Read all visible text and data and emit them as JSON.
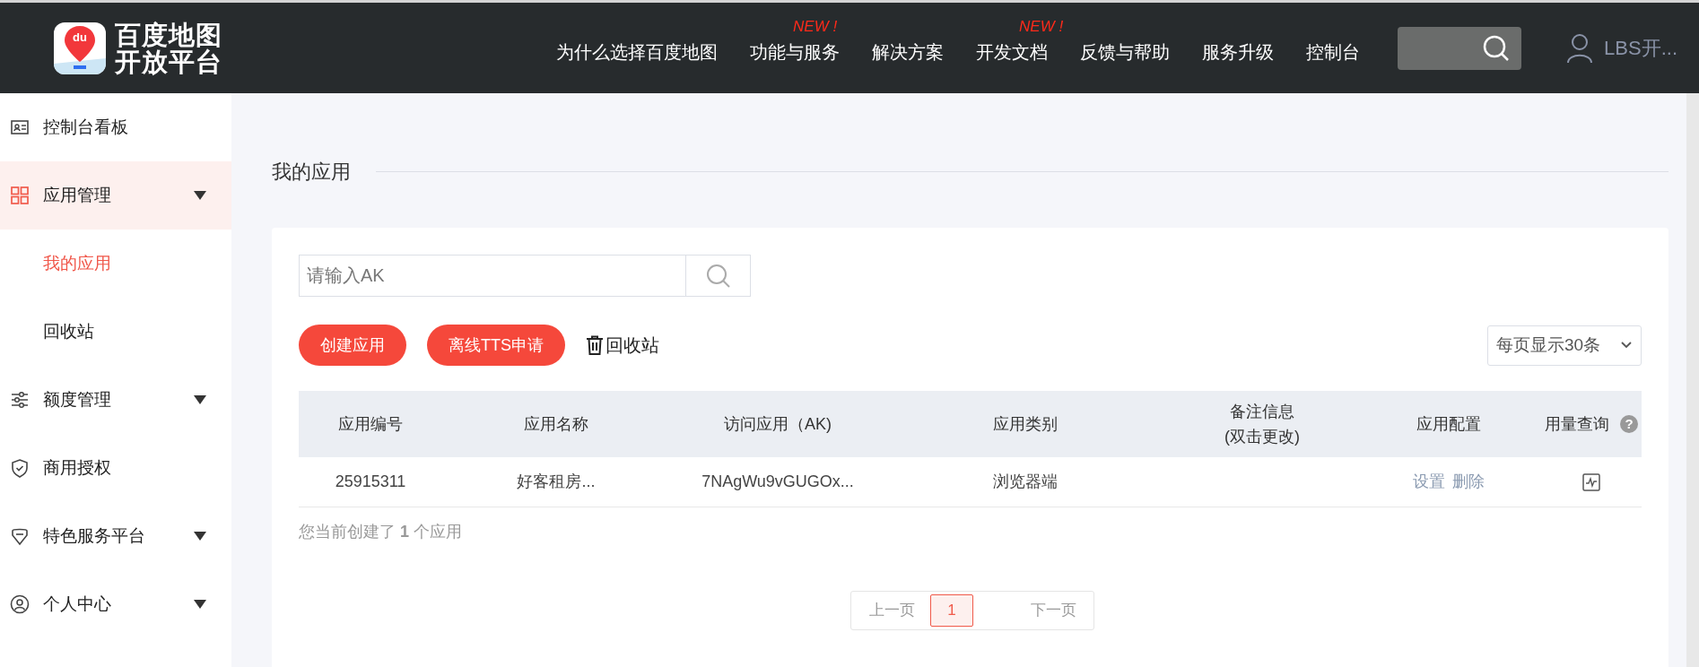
{
  "header": {
    "logo_badge": "du",
    "logo_lines": [
      "百度地图",
      "开放平台"
    ],
    "nav": [
      {
        "label": "为什么选择百度地图"
      },
      {
        "label": "功能与服务",
        "badge": "NEW !"
      },
      {
        "label": "解决方案"
      },
      {
        "label": "开发文档",
        "badge": "NEW !"
      },
      {
        "label": "反馈与帮助"
      },
      {
        "label": "服务升级"
      },
      {
        "label": "控制台"
      }
    ],
    "user": "LBS开..."
  },
  "sidebar": {
    "items": [
      {
        "label": "控制台看板",
        "expandable": false,
        "selected": false
      },
      {
        "label": "应用管理",
        "expandable": true,
        "selected": true,
        "children": [
          {
            "label": "我的应用",
            "selected": true
          },
          {
            "label": "回收站",
            "selected": false
          }
        ]
      },
      {
        "label": "额度管理",
        "expandable": true,
        "selected": false
      },
      {
        "label": "商用授权",
        "expandable": false,
        "selected": false
      },
      {
        "label": "特色服务平台",
        "expandable": true,
        "selected": false
      },
      {
        "label": "个人中心",
        "expandable": true,
        "selected": false
      }
    ]
  },
  "page_title": "我的应用",
  "search": {
    "placeholder": "请输入AK"
  },
  "buttons": [
    {
      "label": "创建应用",
      "kind": "primary"
    },
    {
      "label": "离线TTS申请",
      "kind": "primary"
    },
    {
      "label": "回收站",
      "kind": "trash"
    }
  ],
  "page_size": "每页显示30条",
  "table": {
    "columns": [
      {
        "label": "应用编号"
      },
      {
        "label": "应用名称"
      },
      {
        "label": "访问应用（AK)"
      },
      {
        "label": "应用类别"
      },
      {
        "label": "备注信息\n(双击更改)"
      },
      {
        "label": "应用配置"
      },
      {
        "label": "用量查询",
        "help_icon": "?"
      }
    ],
    "rows": [
      {
        "cells": [
          "25915311",
          "好客租房...",
          "7NAgWu9vGUGOx...",
          "浏览器端",
          ""
        ],
        "actions": [
          "设置",
          "删除"
        ]
      }
    ]
  },
  "summary": "您当前创建了 **1** 个应用",
  "pagination": {
    "prev": "上一页",
    "pages": [
      {
        "label": "1",
        "selected": true
      }
    ],
    "next": "下一页"
  }
}
